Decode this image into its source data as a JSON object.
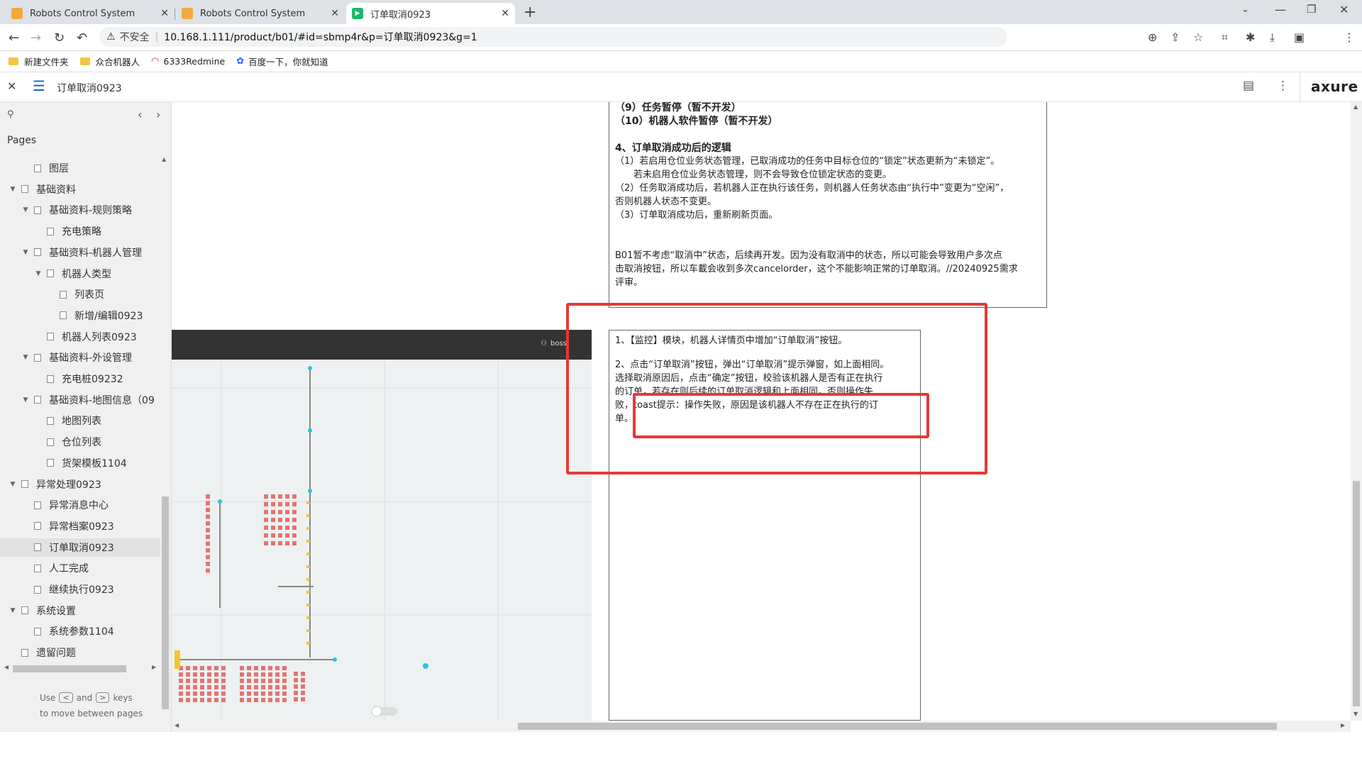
{
  "tabs": [
    {
      "title": "Robots Control System",
      "active": false
    },
    {
      "title": "Robots Control System",
      "active": false
    },
    {
      "title": "订单取消0923",
      "active": true
    }
  ],
  "new_tab": "+",
  "address": {
    "security": "不安全",
    "url": "10.168.1.111/product/b01/#id=sbmp4r&p=订单取消0923&g=1"
  },
  "bookmarks": [
    "新建文件夹",
    "众合机器人",
    "6333Redmine",
    "百度一下，你就知道"
  ],
  "axure": {
    "page_title": "订单取消0923",
    "logo": "axure"
  },
  "sidebar": {
    "heading": "Pages",
    "items": [
      {
        "label": "图层",
        "level": 1,
        "arrow": ""
      },
      {
        "label": "基础资料",
        "level": 0,
        "arrow": "▼"
      },
      {
        "label": "基础资料-规则策略",
        "level": 1,
        "arrow": "▼"
      },
      {
        "label": "充电策略",
        "level": 2,
        "arrow": ""
      },
      {
        "label": "基础资料-机器人管理",
        "level": 1,
        "arrow": "▼"
      },
      {
        "label": "机器人类型",
        "level": 2,
        "arrow": "▼"
      },
      {
        "label": "列表页",
        "level": 3,
        "arrow": ""
      },
      {
        "label": "新增/编辑0923",
        "level": 3,
        "arrow": ""
      },
      {
        "label": "机器人列表0923",
        "level": 2,
        "arrow": ""
      },
      {
        "label": "基础资料-外设管理",
        "level": 1,
        "arrow": "▼"
      },
      {
        "label": "充电桩09232",
        "level": 2,
        "arrow": ""
      },
      {
        "label": "基础资料-地图信息（09",
        "level": 1,
        "arrow": "▼"
      },
      {
        "label": "地图列表",
        "level": 2,
        "arrow": ""
      },
      {
        "label": "仓位列表",
        "level": 2,
        "arrow": ""
      },
      {
        "label": "货架模板1104",
        "level": 2,
        "arrow": ""
      },
      {
        "label": "异常处理0923",
        "level": 0,
        "arrow": "▼"
      },
      {
        "label": "异常消息中心",
        "level": 1,
        "arrow": ""
      },
      {
        "label": "异常档案0923",
        "level": 1,
        "arrow": ""
      },
      {
        "label": "订单取消0923",
        "level": 1,
        "arrow": "",
        "selected": true
      },
      {
        "label": "人工完成",
        "level": 1,
        "arrow": ""
      },
      {
        "label": "继续执行0923",
        "level": 1,
        "arrow": ""
      },
      {
        "label": "系统设置",
        "level": 0,
        "arrow": "▼"
      },
      {
        "label": "系统参数1104",
        "level": 1,
        "arrow": ""
      },
      {
        "label": "遗留问题",
        "level": 0,
        "arrow": ""
      }
    ],
    "hint_use": "Use",
    "hint_and": "and",
    "hint_keys": "keys",
    "hint_line2": "to move between pages"
  },
  "note_top": {
    "lines": [
      "（9）任务暂停（暂不开发）",
      "（10）机器人软件暂停（暂不开发）",
      "",
      "4、订单取消成功后的逻辑",
      "（1）若启用仓位业务状态管理，已取消成功的任务中目标仓位的“锁定”状态更新为“未锁定”。",
      "　　若未启用仓位业务状态管理，则不会导致仓位锁定状态的变更。",
      "（2）任务取消成功后，若机器人正在执行该任务，则机器人任务状态由“执行中”变更为“空闲”，",
      "否则机器人状态不变更。",
      "（3）订单取消成功后，重新刷新页面。",
      "",
      "",
      "B01暂不考虑“取消中”状态，后续再开发。因为没有取消中的状态，所以可能会导致用户多次点",
      "击取消按钮，所以车載会收到多次cancelorder，这个不能影响正常的订单取消。//20240925需求",
      "评审。"
    ]
  },
  "note_main": {
    "p1": "1、【监控】模块，机器人详情页中增加“订单取消”按钮。",
    "p2_lines": [
      "2、点击“订单取消”按钮，弹出“订单取消”提示弹窗，如上面相同。",
      "选择取消原因后，点击“确定”按钮，校验该机器人是否有正在执行",
      "的订单，若存在则后续的订单取消逻辑和上面相同，否则操作失",
      "败，toast提示：操作失败，原因是该机器人不存在正在执行的订",
      "单。"
    ]
  },
  "map_panel": {
    "user": "boss"
  },
  "colors": {
    "accent_red": "#e53935",
    "shelf_red": "#e57373",
    "robot_yellow": "#f4c430",
    "path_cyan": "#26c6da"
  }
}
